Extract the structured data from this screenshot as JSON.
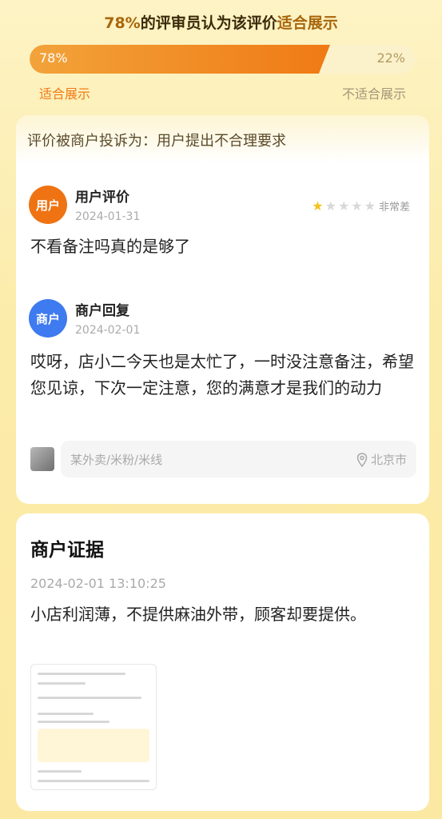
{
  "vote": {
    "headline_pct": "78%",
    "headline_mid": "的评审员认为该评价",
    "headline_highlight": "适合展示",
    "suitable_pct_label": "78%",
    "unsuitable_pct_label": "22%",
    "suitable_fraction": 0.78,
    "suitable_label": "适合展示",
    "unsuitable_label": "不适合展示"
  },
  "complaint": {
    "header": "评价被商户投诉为：用户提出不合理要求",
    "user": {
      "avatar_label": "用户",
      "name": "用户评价",
      "date": "2024-01-31",
      "rating": 1,
      "rating_max": 5,
      "rating_text": "非常差",
      "text": "不看备注吗真的是够了"
    },
    "merchant": {
      "avatar_label": "商户",
      "name": "商户回复",
      "date": "2024-02-01",
      "text": "哎呀，店小二今天也是太忙了，一时没注意备注，希望您见谅，下次一定注意，您的满意才是我们的动力"
    },
    "store": {
      "name": "某外卖/米粉/米线",
      "location": "北京市"
    }
  },
  "evidence": {
    "title": "商户证据",
    "time": "2024-02-01 13:10:25",
    "text": "小店利润薄，不提供麻油外带，顾客却要提供。"
  },
  "colors": {
    "accent_orange": "#f07a15",
    "gold_text": "#a8660c",
    "user_avatar": "#ef7313",
    "merchant_avatar": "#3e7af0",
    "star_on": "#f4c21a"
  },
  "icons": {
    "star": "star-icon",
    "location": "location-pin-icon"
  }
}
